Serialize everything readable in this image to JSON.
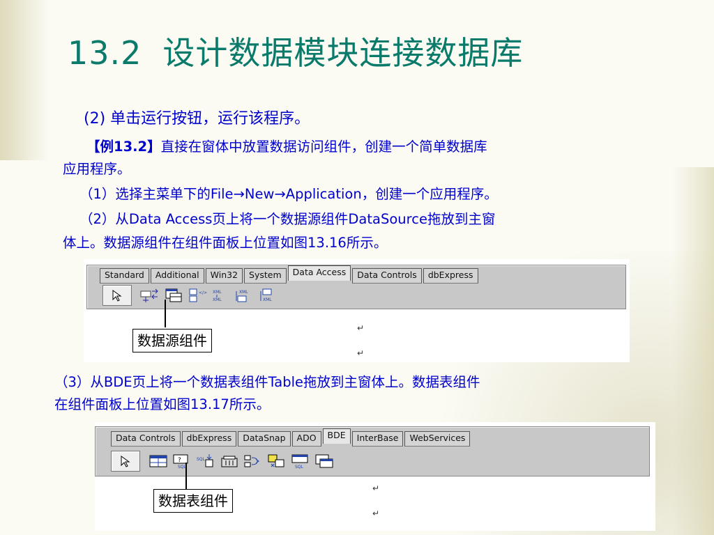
{
  "slide": {
    "title_num": "13.2",
    "title_text": "设计数据模块连接数据库",
    "p1": "(2) 单击运行按钮，运行该程序。",
    "p2_bold": "【例13.2】",
    "p2_rest": "直接在窗体中放置数据访问组件，创建一个简单数据库",
    "p2_cont": "应用程序。",
    "p3": "（1）选择主菜单下的File→New→Application，创建一个应用程序。",
    "p4": "（2）从Data Access页上将一个数据源组件DataSource拖放到主窗",
    "p4_cont": "体上。数据源组件在组件面板上位置如图13.16所示。",
    "p5": "（3）从BDE页上将一个数据表组件Table拖放到主窗体上。数据表组件",
    "p5_cont": "在组件面板上位置如图13.17所示。"
  },
  "palette1": {
    "tabs": [
      "Standard",
      "Additional",
      "Win32",
      "System",
      "Data Access",
      "Data Controls",
      "dbExpress"
    ],
    "active_tab": "Data Access",
    "label": "数据源组件",
    "icons": [
      "pointer-icon",
      "datasource-icon",
      "table-icon",
      "query-icon",
      "xml-transform-icon",
      "xml-provider-icon",
      "client-dataset-icon",
      "xml-broker-icon"
    ]
  },
  "palette2": {
    "tabs": [
      "Data Controls",
      "dbExpress",
      "DataSnap",
      "ADO",
      "BDE",
      "InterBase",
      "WebServices"
    ],
    "active_tab": "BDE",
    "label": "数据表组件",
    "icons": [
      "pointer-icon",
      "table-icon",
      "query-icon",
      "stored-proc-icon",
      "database-icon",
      "session-icon",
      "batch-move-icon",
      "update-sql-icon",
      "nested-table-icon"
    ]
  },
  "colors": {
    "title": "#0a7a6a",
    "body_text": "#0000cc"
  }
}
